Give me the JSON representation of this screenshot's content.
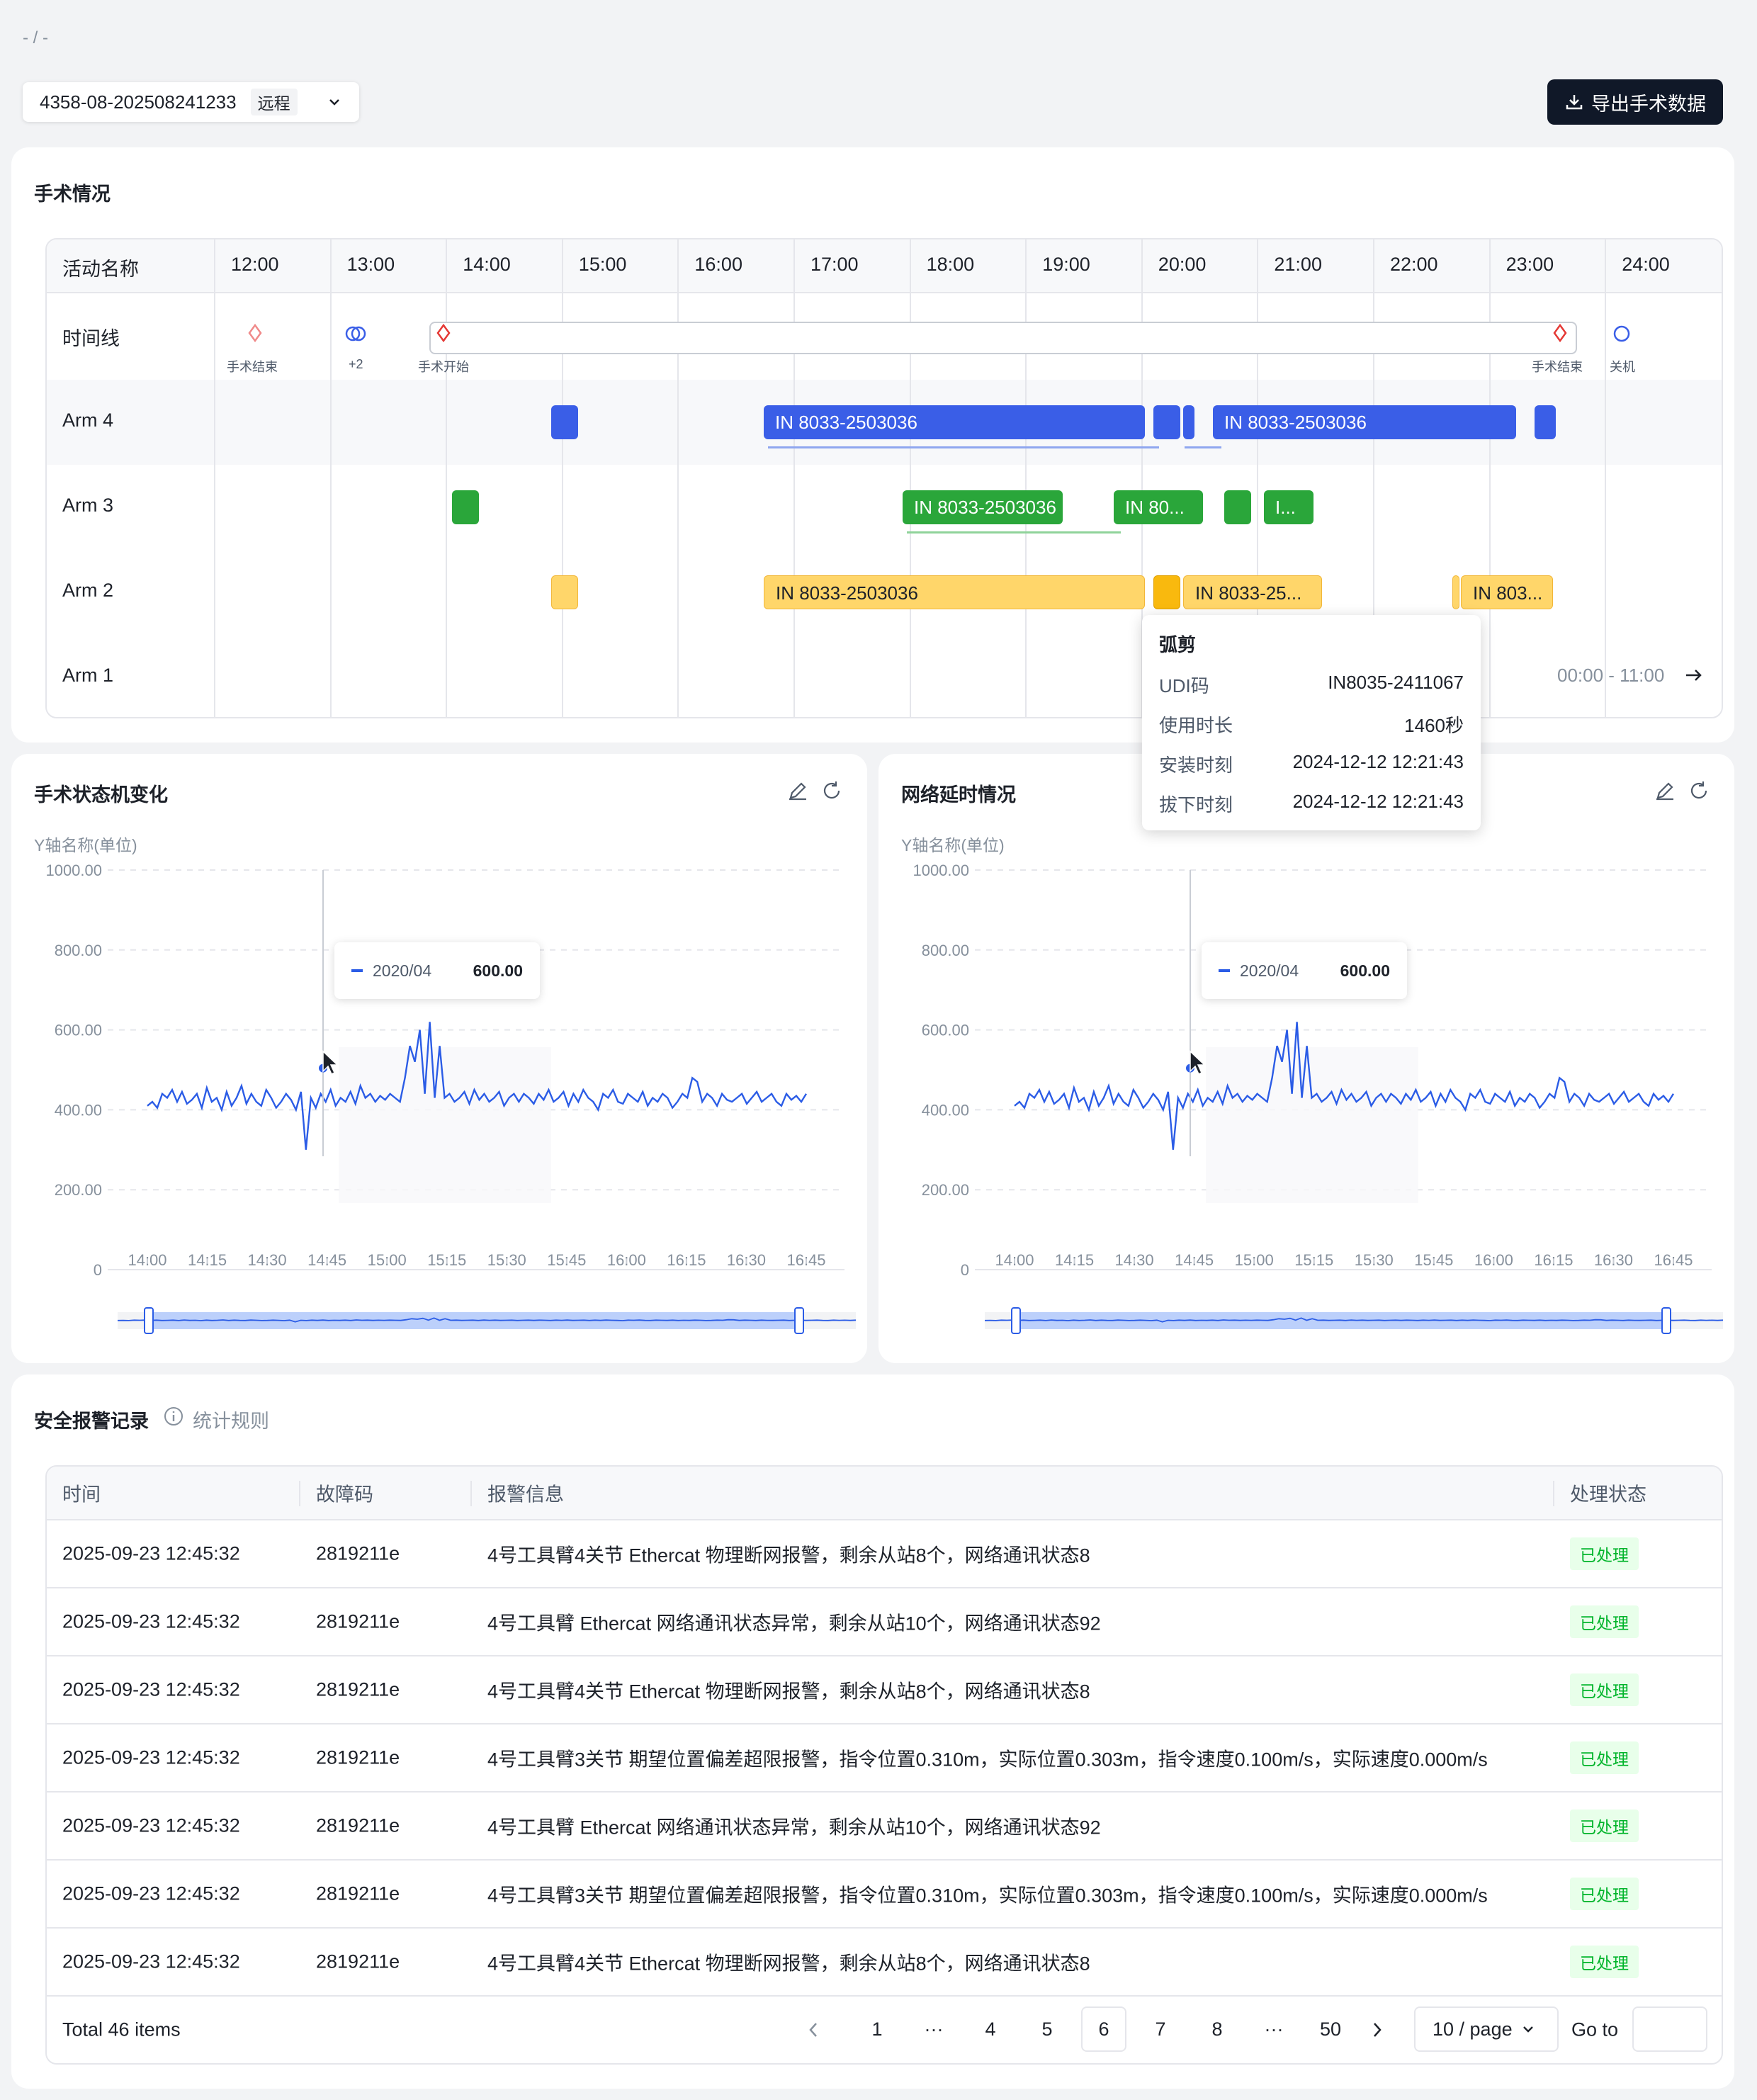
{
  "breadcrumb": "- / -",
  "header": {
    "case_id": "4358-08-202508241233",
    "case_tag": "远程",
    "export_label": "导出手术数据"
  },
  "surgery": {
    "title": "手术情况",
    "col_header": "活动名称",
    "hours": [
      "12:00",
      "13:00",
      "14:00",
      "15:00",
      "16:00",
      "17:00",
      "18:00",
      "19:00",
      "20:00",
      "21:00",
      "22:00",
      "23:00",
      "24:00"
    ],
    "rows": [
      "时间线",
      "Arm 4",
      "Arm 3",
      "Arm 2",
      "Arm 1"
    ],
    "markers": {
      "end1": "手术结束",
      "plus": "+2",
      "start": "手术开始",
      "end2": "手术结束",
      "off": "关机"
    },
    "bar_label": "IN 8033-2503036",
    "bar_label_short1": "IN 80...",
    "bar_label_short2": "I...",
    "bar_label_short3": "IN 8033-25...",
    "bar_label_short4": "IN 803...",
    "range": "00:00 - 11:00"
  },
  "tooltip": {
    "title": "弧剪",
    "rows": [
      {
        "k": "UDI码",
        "v": "IN8035-2411067"
      },
      {
        "k": "使用时长",
        "v": "1460秒"
      },
      {
        "k": "安装时刻",
        "v": "2024-12-12 12:21:43"
      },
      {
        "k": "拔下时刻",
        "v": "2024-12-12 12:21:43"
      }
    ]
  },
  "chart_state": {
    "title": "手术状态机变化",
    "ylabel": "Y轴名称(单位)",
    "tooltip_name": "2020/04",
    "tooltip_value": "600.00"
  },
  "chart_net": {
    "title": "网络延时情况",
    "ylabel": "Y轴名称(单位)",
    "tooltip_name": "2020/04",
    "tooltip_value": "600.00"
  },
  "chart_data": [
    {
      "type": "line",
      "title": "手术状态机变化",
      "ylabel": "Y轴名称(单位)",
      "ylim": [
        0,
        1000
      ],
      "yticks": [
        "1000.00",
        "800.00",
        "600.00",
        "400.00",
        "200.00",
        "0"
      ],
      "xticks": [
        "14:00",
        "14:15",
        "14:30",
        "14:45",
        "15:00",
        "15:15",
        "15:30",
        "15:45",
        "16:00",
        "16:15",
        "16:30",
        "16:45"
      ],
      "series": [
        {
          "values": [
            410,
            420,
            405,
            440,
            430,
            450,
            420,
            445,
            415,
            425,
            440,
            405,
            455,
            420,
            430,
            400,
            445,
            410,
            430,
            460,
            415,
            440,
            420,
            410,
            450,
            430,
            405,
            420,
            440,
            425,
            400,
            445,
            300,
            430,
            405,
            440,
            420,
            450,
            410,
            430,
            420,
            445,
            415,
            460,
            430,
            440,
            420,
            435,
            425,
            440,
            430,
            420,
            480,
            560,
            520,
            600,
            440,
            620,
            430,
            560,
            430,
            440,
            420,
            430,
            445,
            415,
            450,
            425,
            440,
            420,
            430,
            445,
            410,
            430,
            440,
            420,
            440,
            430,
            415,
            440,
            425,
            450,
            420,
            430,
            445,
            410,
            440,
            420,
            450,
            430,
            420,
            400,
            440,
            430,
            450,
            420,
            415,
            440,
            430,
            420,
            445,
            410,
            430,
            420,
            440,
            430,
            405,
            420,
            440,
            430,
            480,
            470,
            420,
            440,
            430,
            410,
            440,
            425,
            420,
            430,
            440,
            415,
            430,
            445,
            420,
            430,
            440,
            420,
            410,
            440,
            425,
            435,
            420,
            440
          ]
        }
      ]
    },
    {
      "type": "line",
      "title": "网络延时情况",
      "ylabel": "Y轴名称(单位)",
      "ylim": [
        0,
        1000
      ],
      "yticks": [
        "1000.00",
        "800.00",
        "600.00",
        "400.00",
        "200.00",
        "0"
      ],
      "xticks": [
        "14:00",
        "14:15",
        "14:30",
        "14:45",
        "15:00",
        "15:15",
        "15:30",
        "15:45",
        "16:00",
        "16:15",
        "16:30",
        "16:45"
      ],
      "series": [
        {
          "values": [
            410,
            420,
            405,
            440,
            430,
            450,
            420,
            445,
            415,
            425,
            440,
            405,
            455,
            420,
            430,
            400,
            445,
            410,
            430,
            460,
            415,
            440,
            420,
            410,
            450,
            430,
            405,
            420,
            440,
            425,
            400,
            445,
            300,
            430,
            405,
            440,
            420,
            450,
            410,
            430,
            420,
            445,
            415,
            460,
            430,
            440,
            420,
            435,
            425,
            440,
            430,
            420,
            480,
            560,
            520,
            600,
            440,
            620,
            430,
            560,
            430,
            440,
            420,
            430,
            445,
            415,
            450,
            425,
            440,
            420,
            430,
            445,
            410,
            430,
            440,
            420,
            440,
            430,
            415,
            440,
            425,
            450,
            420,
            430,
            445,
            410,
            440,
            420,
            450,
            430,
            420,
            400,
            440,
            430,
            450,
            420,
            415,
            440,
            430,
            420,
            445,
            410,
            430,
            420,
            440,
            430,
            405,
            420,
            440,
            430,
            480,
            470,
            420,
            440,
            430,
            410,
            440,
            425,
            420,
            430,
            440,
            415,
            430,
            445,
            420,
            430,
            440,
            420,
            410,
            440,
            425,
            435,
            420,
            440
          ]
        }
      ]
    }
  ],
  "alarms": {
    "title": "安全报警记录",
    "rule_label": "统计规则",
    "columns": [
      "时间",
      "故障码",
      "报警信息",
      "处理状态"
    ],
    "rows": [
      {
        "time": "2025-09-23 12:45:32",
        "code": "2819211e",
        "msg": "4号工具臂4关节 Ethercat 物理断网报警，剩余从站8个，网络通讯状态8",
        "status": "已处理"
      },
      {
        "time": "2025-09-23 12:45:32",
        "code": "2819211e",
        "msg": "4号工具臂 Ethercat 网络通讯状态异常，剩余从站10个，网络通讯状态92",
        "status": "已处理"
      },
      {
        "time": "2025-09-23 12:45:32",
        "code": "2819211e",
        "msg": "4号工具臂4关节 Ethercat 物理断网报警，剩余从站8个，网络通讯状态8",
        "status": "已处理"
      },
      {
        "time": "2025-09-23 12:45:32",
        "code": "2819211e",
        "msg": "4号工具臂3关节 期望位置偏差超限报警，指令位置0.310m，实际位置0.303m，指令速度0.100m/s，实际速度0.000m/s",
        "status": "已处理"
      },
      {
        "time": "2025-09-23 12:45:32",
        "code": "2819211e",
        "msg": "4号工具臂 Ethercat 网络通讯状态异常，剩余从站10个，网络通讯状态92",
        "status": "已处理"
      },
      {
        "time": "2025-09-23 12:45:32",
        "code": "2819211e",
        "msg": "4号工具臂3关节 期望位置偏差超限报警，指令位置0.310m，实际位置0.303m，指令速度0.100m/s，实际速度0.000m/s",
        "status": "已处理"
      },
      {
        "time": "2025-09-23 12:45:32",
        "code": "2819211e",
        "msg": "4号工具臂4关节 Ethercat 物理断网报警，剩余从站8个，网络通讯状态8",
        "status": "已处理"
      }
    ],
    "total": "Total 46 items",
    "pages": [
      "1",
      "···",
      "4",
      "5",
      "6",
      "7",
      "8",
      "···",
      "50"
    ],
    "page_size": "10 / page",
    "goto": "Go to"
  },
  "colors": {
    "blue": "#3a5ee7",
    "green": "#2aa63a",
    "yellow": "#ffd66a",
    "orange": "#f9b90e",
    "line": "#2b5ce6"
  }
}
